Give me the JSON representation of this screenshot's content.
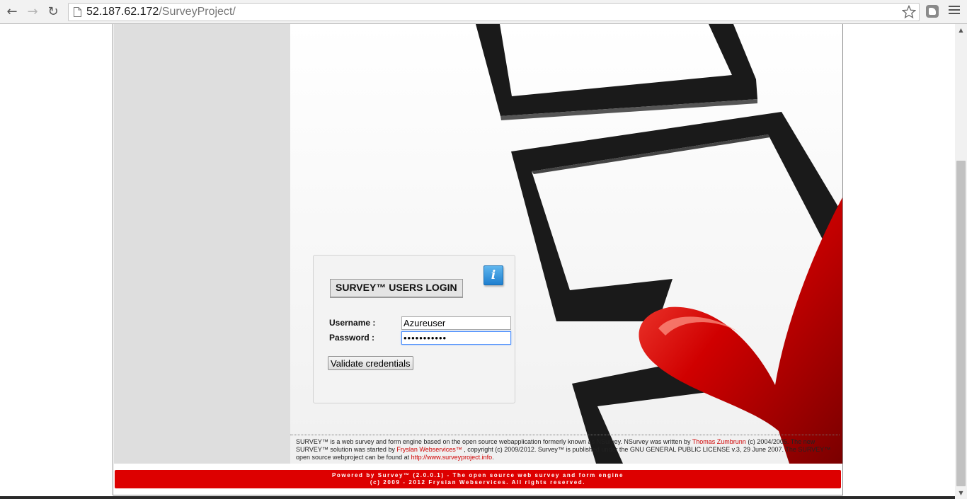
{
  "browser": {
    "url_host": "52.187.62.172",
    "url_path": "/SurveyProject/",
    "back_glyph": "←",
    "forward_glyph": "→",
    "reload_glyph": "↻",
    "icons": [
      "back-arrow-icon",
      "forward-arrow-icon",
      "reload-icon",
      "page-icon",
      "star-icon",
      "extension-icon",
      "menu-icon"
    ]
  },
  "login": {
    "title": "SURVEY™ USERS LOGIN",
    "username_label": "Username :",
    "password_label": "Password :",
    "username_value": "Azureuser",
    "password_value": "•••••••••••",
    "submit_label": "Validate credentials",
    "info_glyph": "i"
  },
  "footer": {
    "text_1": "SURVEY™ is a web survey and form engine based on the open source webapplication formerly known as NSurvey. NSurvey was written by ",
    "author": "Thomas Zumbrunn",
    "text_2": " (c) 2004/2005. The new SURVEY™ solution was started by ",
    "company": "Fryslan Webservices™",
    "text_3": " , copyright (c) 2009/2012. Survey™ is published under the GNU GENERAL PUBLIC LICENSE v.3, 29 June 2007. The SURVEY™ open source webproject can be found at ",
    "link": "http://www.surveyproject.info",
    "text_4": "."
  },
  "powered_bar": {
    "line_1": "Powered by Survey™ (2.0.0.1) - The open source web survey and form engine",
    "line_2": "(c) 2009 - 2012 Frysian Webservices. All rights reserved."
  },
  "colors": {
    "accent_red": "#dd0000",
    "link_red": "#d00000",
    "sidebar_gray": "#dedede"
  }
}
